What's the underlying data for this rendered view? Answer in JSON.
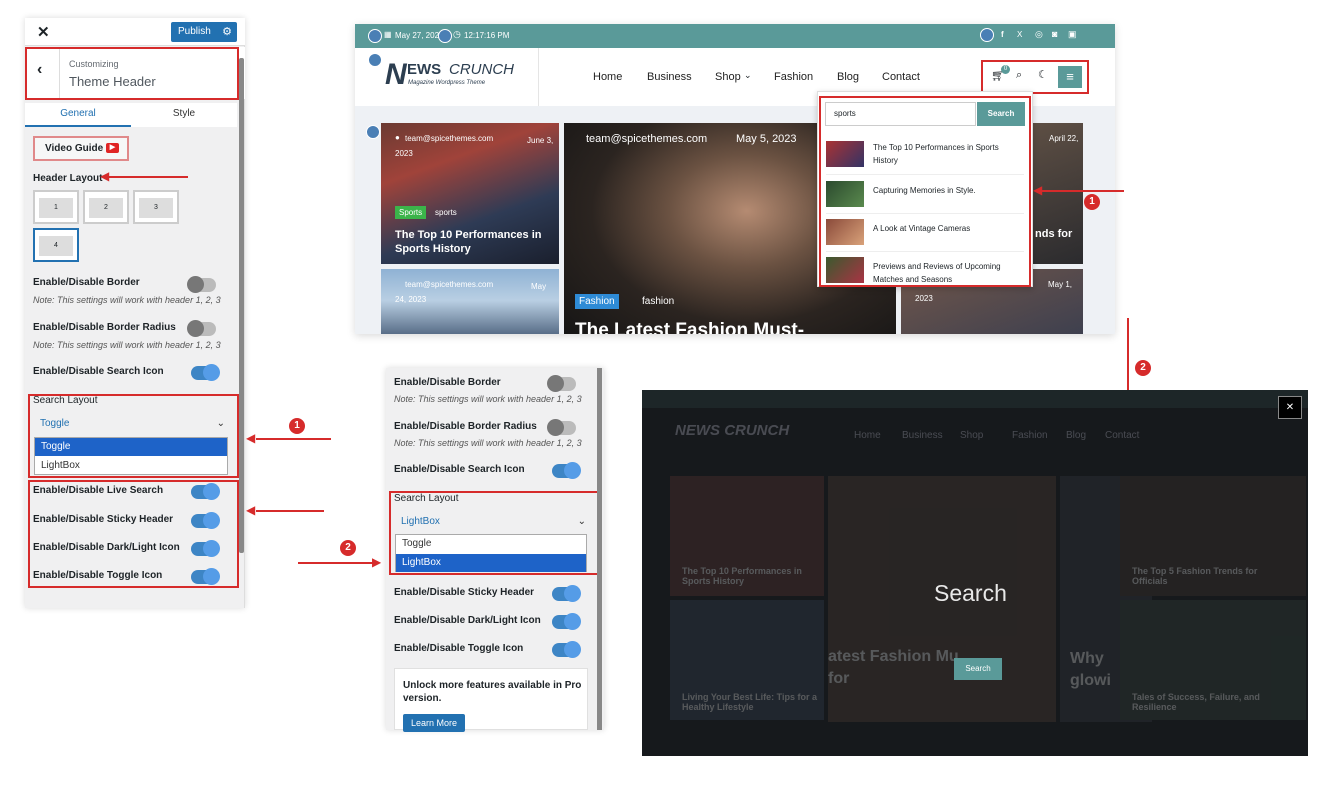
{
  "customizer": {
    "publish_label": "Publish",
    "customizing_label": "Customizing",
    "section_title": "Theme Header",
    "tab_general": "General",
    "tab_style": "Style",
    "video_guide": "Video Guide",
    "header_layout_label": "Header Layout",
    "layouts": [
      "1",
      "2",
      "3",
      "4"
    ],
    "border_label": "Enable/Disable Border",
    "border_note": "Note: This settings will work with header 1, 2, 3",
    "border_radius_label": "Enable/Disable Border Radius",
    "border_radius_note": "Note: This settings will work with header 1, 2, 3",
    "search_icon_label": "Enable/Disable Search Icon",
    "search_layout_label": "Search Layout",
    "search_layout_value": "Toggle",
    "options": [
      "Toggle",
      "LightBox"
    ],
    "live_search_label": "Enable/Disable Live Search",
    "sticky_label": "Enable/Disable Sticky Header",
    "dark_light_label": "Enable/Disable Dark/Light Icon",
    "toggle_icon_label": "Enable/Disable Toggle Icon"
  },
  "panel2": {
    "search_layout_value": "LightBox",
    "pro_text": "Unlock more features available in Pro version.",
    "learn_more": "Learn More"
  },
  "site": {
    "date": "May 27, 202",
    "time": "12:17:16 PM",
    "logo_main": "EWS",
    "logo_n": "N",
    "logo_crunch": "CRUNCH",
    "tagline": "Magazine Wordpress Theme",
    "nav": [
      "Home",
      "Business",
      "Shop",
      "Fashion",
      "Blog",
      "Contact"
    ],
    "cart_count": "0",
    "search_value": "sports",
    "search_button": "Search",
    "results": [
      "The Top 10 Performances in Sports History",
      "Capturing Memories in Style.",
      "A Look at Vintage Cameras",
      "Previews and Reviews of Upcoming Matches and Seasons"
    ],
    "post1_author": "team@spicethemes.com",
    "post1_date": "June 3, 2023",
    "post1_cat": "Sports",
    "post1_tag": "sports",
    "post1_title": "The Top 10 Performances in Sports History",
    "post2_author": "team@spicethemes.com",
    "post2_date": "May 24, 2023",
    "hero_author": "team@spicethemes.com",
    "hero_date": "May 5, 2023",
    "hero_cat": "Fashion",
    "hero_tag": "fashion",
    "hero_title": "The Latest Fashion Must-",
    "right_date": "April 22,",
    "right_title": "nds for",
    "right_year": "2023",
    "right_date2": "May 1,"
  },
  "lightbox": {
    "search_text": "Search",
    "button": "Search",
    "bg_nav": [
      "Home",
      "Business",
      "Shop",
      "Fashion",
      "Blog",
      "Contact"
    ],
    "bg_title1": "The Top 10 Performances in Sports History",
    "bg_title2": "The Top 5 Fashion Trends for Officials",
    "bg_title3": "Living Your Best Life: Tips for a Healthy Lifestyle",
    "bg_title4": "Tales of Success, Failure, and Resilience",
    "bg_hero": "atest Fashion Mu",
    "bg_hero2": "for",
    "bg_why": "Why glowi"
  },
  "badges": [
    "1",
    "2"
  ]
}
